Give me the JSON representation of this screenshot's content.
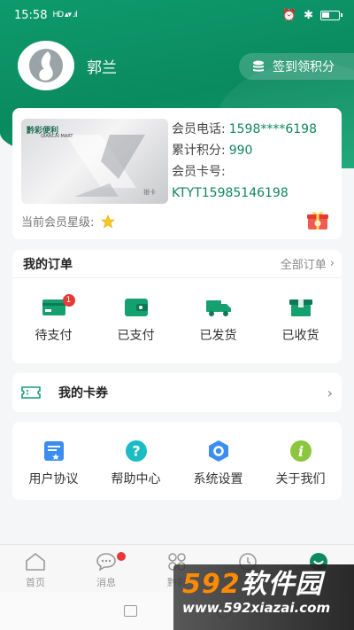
{
  "status_bar": {
    "time": "15:58",
    "signal": "HD ▴▾ .ıl"
  },
  "profile": {
    "name": "郭兰",
    "checkin_label": "签到领积分"
  },
  "member_card": {
    "card_brand": "黔彩便利",
    "card_brand_sub": "QIANCAI MART",
    "card_type": "银卡",
    "phone_label": "会员电话:",
    "phone_value": "1598****6198",
    "points_label": "累计积分:",
    "points_value": "990",
    "card_no_label": "会员卡号:",
    "card_no_value": "KTYT15985146198",
    "star_label": "当前会员星级:",
    "star_count": 1
  },
  "orders": {
    "title": "我的订单",
    "more_label": "全部订单",
    "items": [
      {
        "label": "待支付",
        "icon": "card-icon",
        "badge": "1"
      },
      {
        "label": "已支付",
        "icon": "wallet-icon"
      },
      {
        "label": "已发货",
        "icon": "truck-icon"
      },
      {
        "label": "已收货",
        "icon": "box-icon"
      }
    ]
  },
  "coupons": {
    "title": "我的卡券"
  },
  "services": {
    "items": [
      {
        "label": "用户协议",
        "icon": "agreement-icon"
      },
      {
        "label": "帮助中心",
        "icon": "help-icon"
      },
      {
        "label": "系统设置",
        "icon": "settings-icon"
      },
      {
        "label": "关于我们",
        "icon": "info-icon"
      }
    ]
  },
  "bottom_nav": {
    "items": [
      {
        "label": "首页",
        "icon": "home-icon"
      },
      {
        "label": "消息",
        "icon": "message-icon"
      },
      {
        "label": "黔彩",
        "icon": "apps-icon"
      },
      {
        "label": "",
        "icon": "clock-icon"
      },
      {
        "label": "",
        "icon": "profile-icon"
      }
    ]
  },
  "watermark": {
    "brand_num": "592",
    "brand_text": "软件园",
    "url": "www.592xiazai.com"
  },
  "colors": {
    "brand": "#0a8a5f",
    "accent_value": "#11855d",
    "badge": "#e53935"
  }
}
